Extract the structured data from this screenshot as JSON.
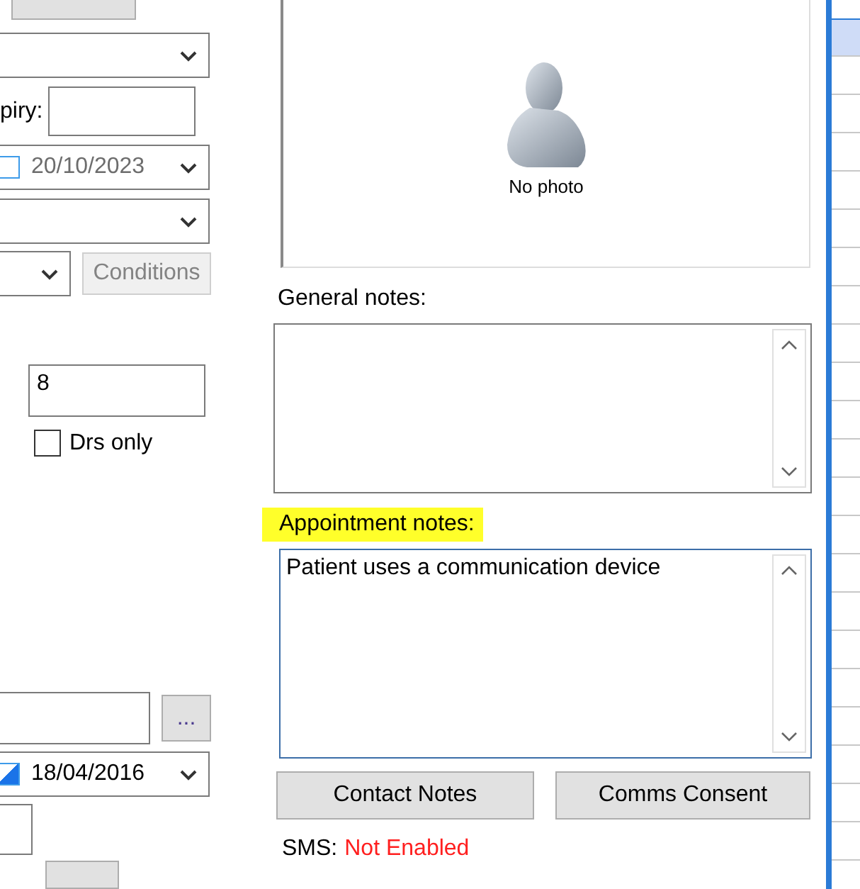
{
  "left_panel": {
    "fields": [
      {
        "kind": "combo"
      },
      {
        "kind": "text",
        "label": "piry:"
      },
      {
        "kind": "date",
        "value": "20/10/2023",
        "checked": false
      },
      {
        "kind": "combo"
      },
      {
        "kind": "combo_button",
        "button": "Conditions",
        "disabled": true
      },
      {
        "kind": "text",
        "value": "8"
      },
      {
        "kind": "checkbox",
        "label": "Drs only",
        "checked": false
      },
      {
        "kind": "browse",
        "button": "..."
      },
      {
        "kind": "date",
        "value": "18/04/2016",
        "checked": true
      },
      {
        "kind": "text"
      }
    ]
  },
  "photo": {
    "caption": "No photo"
  },
  "general_notes": {
    "label": "General notes:"
  },
  "appointment_notes": {
    "label": "Appointment notes:",
    "highlighted": true,
    "value": "Patient uses a communication device"
  },
  "buttons": [
    "Contact Notes",
    "Comms Consent"
  ],
  "sms": {
    "label": "SMS:",
    "status": "Not Enabled",
    "enabled": false
  },
  "grid": {
    "rows": [
      {
        "selected": true
      },
      {
        "selected": false
      },
      {
        "selected": false
      },
      {
        "selected": false
      },
      {
        "selected": false
      },
      {
        "selected": false
      },
      {
        "selected": false
      },
      {
        "selected": false
      },
      {
        "selected": false
      },
      {
        "selected": false
      },
      {
        "selected": false
      },
      {
        "selected": false
      },
      {
        "selected": false
      },
      {
        "selected": false
      },
      {
        "selected": false
      },
      {
        "selected": false
      },
      {
        "selected": false
      },
      {
        "selected": false
      },
      {
        "selected": false
      },
      {
        "selected": false
      },
      {
        "selected": false
      },
      {
        "selected": false
      }
    ]
  }
}
